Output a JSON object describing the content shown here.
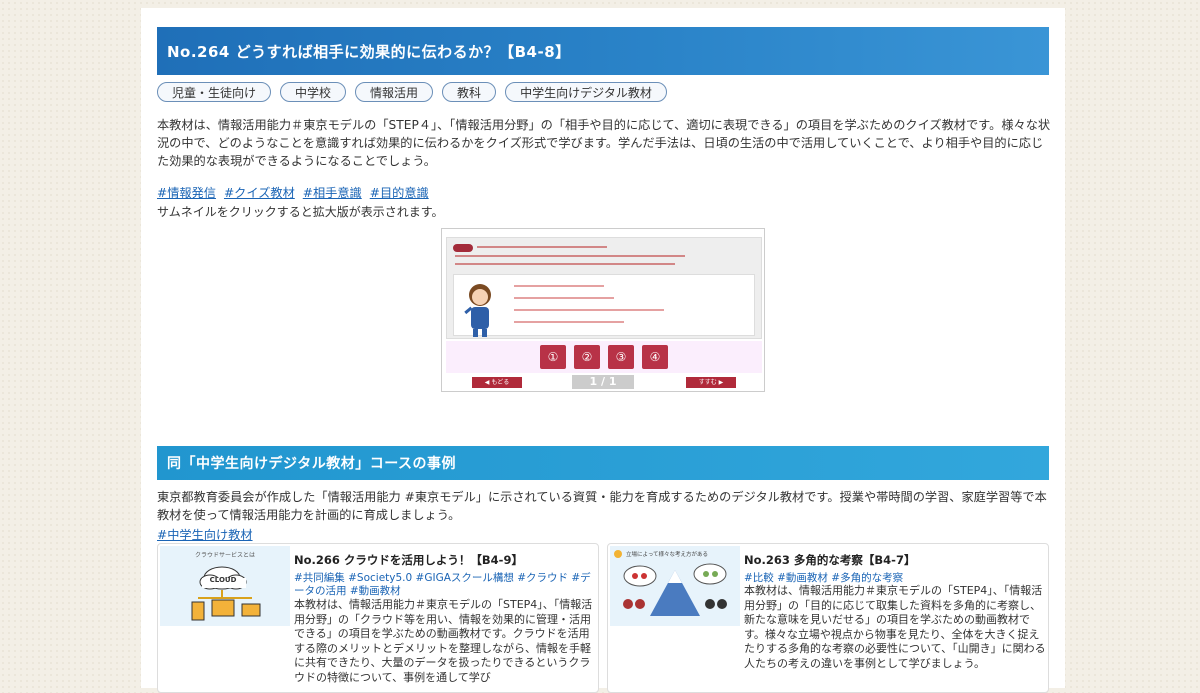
{
  "article": {
    "title": "No.264 どうすれば相手に効果的に伝わるか？【B4-8】",
    "tags": [
      "児童・生徒向け",
      "中学校",
      "情報活用",
      "教科",
      "中学生向けデジタル教材"
    ],
    "description": "本教材は、情報活用能力＃東京モデルの「STEP４」、「情報活用分野」の「相手や目的に応じて、適切に表現できる」の項目を学ぶためのクイズ教材です。様々な状況の中で、どのようなことを意識すれば効果的に伝わるかをクイズ形式で学びます。学んだ手法は、日頃の生活の中で活用していくことで、より相手や目的に応じた効果的な表現ができるようになることでしょう。",
    "hashtags": [
      "#情報発信",
      "#クイズ教材",
      "#相手意識",
      "#目的意識"
    ],
    "thumbnail_note": "サムネイルをクリックすると拡大版が表示されます。",
    "quiz": {
      "answers": [
        "①",
        "②",
        "③",
        "④"
      ],
      "back_label": "◀ もどる",
      "next_label": "すすむ ▶",
      "page_indicator": "1 / 1"
    }
  },
  "course": {
    "title": "同「中学生向けデジタル教材」コースの事例",
    "description": "東京都教育委員会が作成した「情報活用能力 #東京モデル」に示されている資質・能力を育成するためのデジタル教材です。授業や帯時間の学習、家庭学習等で本教材を使って情報活用能力を計画的に育成しましょう。",
    "link": "#中学生向け教材",
    "cards": [
      {
        "title": "No.266 クラウドを活用しよう！【B4-9】",
        "tags": "#共同編集 #Society5.0 #GIGAスクール構想 #クラウド #データの活用 #動画教材",
        "text": "本教材は、情報活用能力＃東京モデルの「STEP4」、「情報活用分野」の「クラウド等を用い、情報を効果的に管理・活用できる」の項目を学ぶための動画教材です。クラウドを活用する際のメリットとデメリットを整理しながら、情報を手軽に共有できたり、大量のデータを扱ったりできるというクラウドの特徴について、事例を通して学び",
        "image_label": "クラウドサービスとは",
        "cloud_label": "CLOUD"
      },
      {
        "title": "No.263 多角的な考察【B4-7】",
        "tags": "#比較 #動画教材 #多角的な考察",
        "text": "本教材は、情報活用能力＃東京モデルの「STEP4」、「情報活用分野」の「目的に応じて取集した資料を多角的に考察し、新たな意味を見いだせる」の項目を学ぶための動画教材です。様々な立場や視点から物事を見たり、全体を大きく捉えたりする多角的な考察の必要性について、「山開き」に関わる人たちの考えの違いを事例として学びましょう。",
        "image_label": "立場によって様々な考え方がある"
      }
    ]
  }
}
